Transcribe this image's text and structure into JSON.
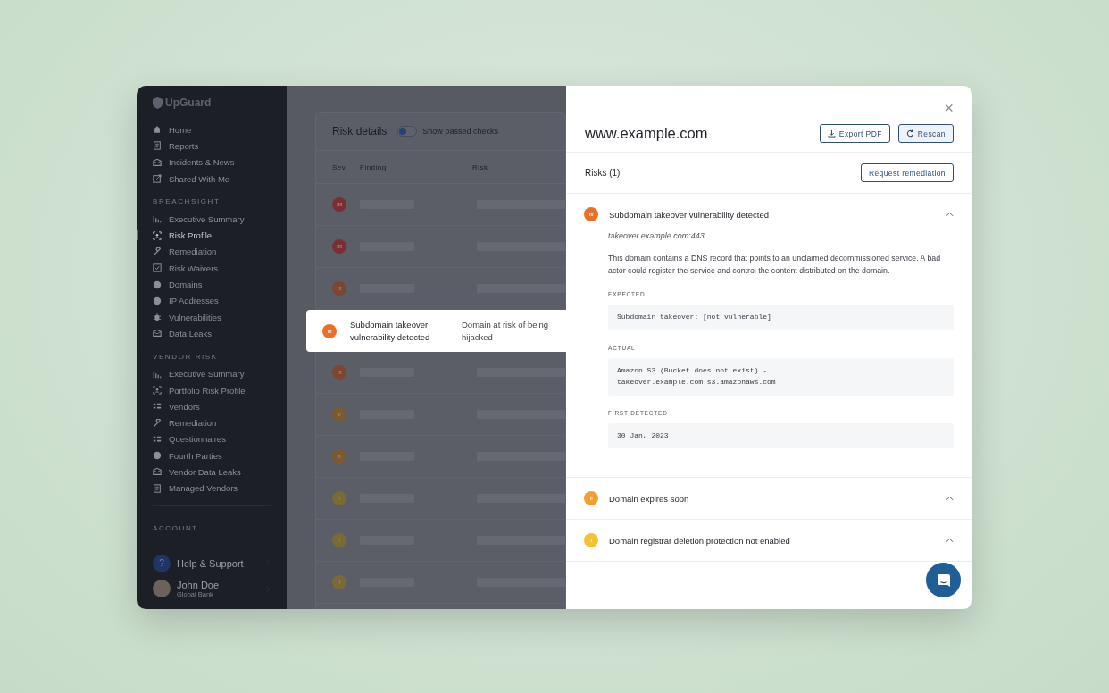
{
  "sidebar": {
    "logo": "UpGuard",
    "sections": [
      {
        "items": [
          {
            "label": "Home",
            "selected": false
          },
          {
            "label": "Reports",
            "selected": false
          },
          {
            "label": "Incidents & News",
            "selected": false
          },
          {
            "label": "Shared With Me",
            "selected": false
          }
        ]
      },
      {
        "heading": "BREACHSIGHT",
        "items": [
          {
            "label": "Executive Summary",
            "selected": false
          },
          {
            "label": "Risk Profile",
            "selected": true
          },
          {
            "label": "Remediation",
            "selected": false
          },
          {
            "label": "Risk Waivers",
            "selected": false
          },
          {
            "label": "Domains",
            "selected": false
          },
          {
            "label": "IP Addresses",
            "selected": false
          },
          {
            "label": "Vulnerabilities",
            "selected": false
          },
          {
            "label": "Data Leaks",
            "selected": false
          }
        ]
      },
      {
        "heading": "VENDOR RISK",
        "items": [
          {
            "label": "Executive Summary",
            "selected": false
          },
          {
            "label": "Portfolio Risk Profile",
            "selected": false
          },
          {
            "label": "Vendors",
            "selected": false
          },
          {
            "label": "Remediation",
            "selected": false
          },
          {
            "label": "Questionnaires",
            "selected": false
          },
          {
            "label": "Fourth Parties",
            "selected": false
          },
          {
            "label": "Vendor Data Leaks",
            "selected": false
          },
          {
            "label": "Managed Vendors",
            "selected": false
          }
        ]
      },
      {
        "heading": "ACCOUNT"
      }
    ],
    "help": {
      "badge": "?",
      "label": "Help & Support"
    },
    "user": {
      "name": "John Doe",
      "org": "Global Bank"
    }
  },
  "risk_details": {
    "title": "Risk details",
    "toggle": {
      "label": "Show passed checks",
      "on": false
    },
    "columns": [
      "Sev.",
      "Finding",
      "Risk"
    ],
    "rows": [
      {
        "color": "#7a2f35",
        "badge": "!!!!",
        "highlighted": false
      },
      {
        "color": "#7a2f35",
        "badge": "!!!!",
        "highlighted": false
      },
      {
        "color": "#7c4630",
        "badge": "!!!",
        "highlighted": false
      },
      {
        "color": "#e8702a",
        "badge": "!!!",
        "highlighted": true,
        "finding": "Subdomain takeover vulnerability detected",
        "risk": "Domain at risk of being hijacked"
      },
      {
        "color": "#7c4630",
        "badge": "!!!",
        "highlighted": false
      },
      {
        "color": "#7a5a30",
        "badge": "!!",
        "highlighted": false
      },
      {
        "color": "#7a5a30",
        "badge": "!!",
        "highlighted": false
      },
      {
        "color": "#7a6a35",
        "badge": "!",
        "highlighted": false
      },
      {
        "color": "#7a6a35",
        "badge": "!",
        "highlighted": false
      },
      {
        "color": "#7a6a35",
        "badge": "!",
        "highlighted": false
      }
    ]
  },
  "panel": {
    "close": "×",
    "title": "www.example.com",
    "export_button": "Export PDF",
    "rescan_button": "Rescan",
    "risks_heading": "Risks (1)",
    "request_button": "Request remediation",
    "risks": [
      {
        "color": "#e8702a",
        "badge": "!!!",
        "title": "Subdomain takeover vulnerability detected",
        "expanded": true,
        "host": "takeover.example.com:443",
        "description": "This domain contains a DNS record that points to an unclaimed decommissioned service. A bad actor could register the service and control the content distributed on the domain.",
        "fields": [
          {
            "label": "EXPECTED",
            "lines": [
              "Subdomain takeover: [not vulnerable]"
            ]
          },
          {
            "label": "ACTUAL",
            "lines": [
              "Amazon S3 (Bucket does not exist) -",
              "takeover.example.com.s3.amazonaws.com"
            ]
          },
          {
            "label": "FIRST DETECTED",
            "lines": [
              "30 Jan, 2023"
            ]
          }
        ]
      },
      {
        "color": "#f0a030",
        "badge": "!!",
        "title": "Domain expires soon",
        "expanded": false
      },
      {
        "color": "#f2c233",
        "badge": "!",
        "title": "Domain registrar deletion protection not enabled",
        "expanded": false
      }
    ]
  }
}
